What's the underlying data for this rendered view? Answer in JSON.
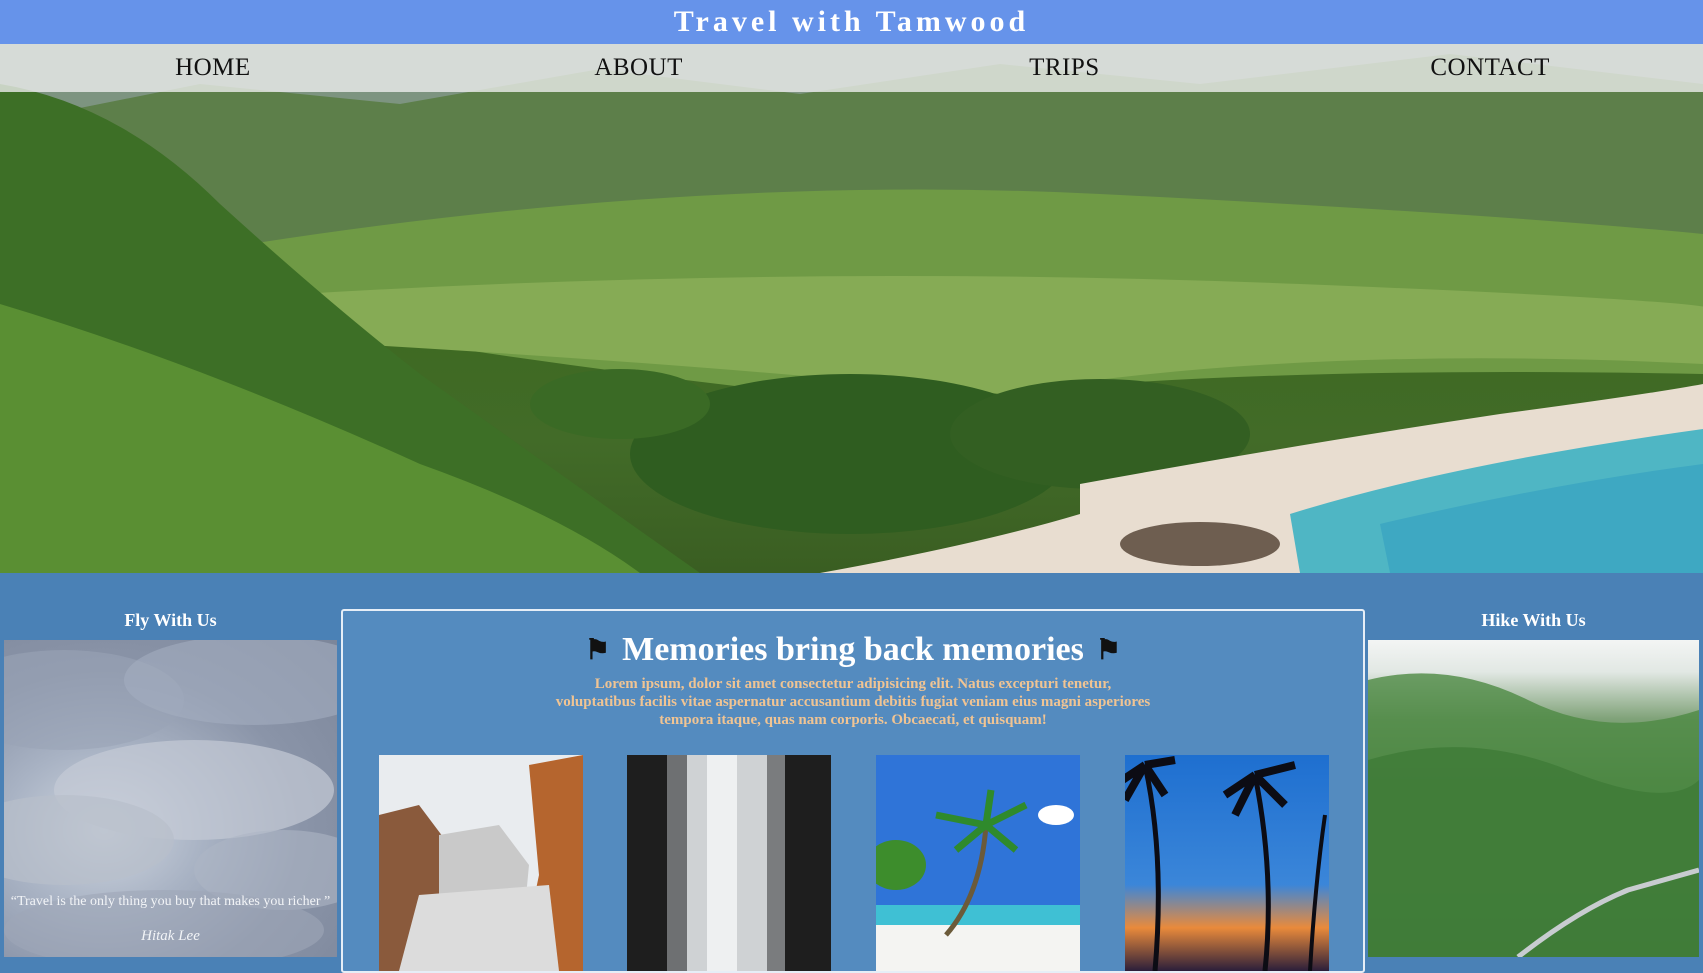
{
  "header": {
    "title": "Travel with Tamwood"
  },
  "nav": {
    "items": [
      {
        "label": "HOME"
      },
      {
        "label": "ABOUT"
      },
      {
        "label": "TRIPS"
      },
      {
        "label": "CONTACT"
      }
    ]
  },
  "left": {
    "title": "Fly With Us",
    "quote": "“Travel is the only thing you buy that makes you richer ”",
    "author": "Hitak Lee"
  },
  "center": {
    "heading": "Memories bring back memories",
    "flag_icon": "⚑",
    "text": "Lorem ipsum, dolor sit amet consectetur adipisicing elit. Natus excepturi tenetur, voluptatibus facilis vitae aspernatur accusantium debitis fugiat veniam eius magni asperiores tempora itaque, quas nam corporis. Obcaecati, et quisquam!",
    "gallery": [
      {
        "icon": "canyon-photo"
      },
      {
        "icon": "waterfall-photo"
      },
      {
        "icon": "beach-palm-photo"
      },
      {
        "icon": "sunset-palms-photo"
      }
    ]
  },
  "right": {
    "title": "Hike With Us"
  },
  "colors": {
    "banner": "#6693ea",
    "section_bg": "#4a81b6",
    "lorem_text": "#f0c493"
  }
}
